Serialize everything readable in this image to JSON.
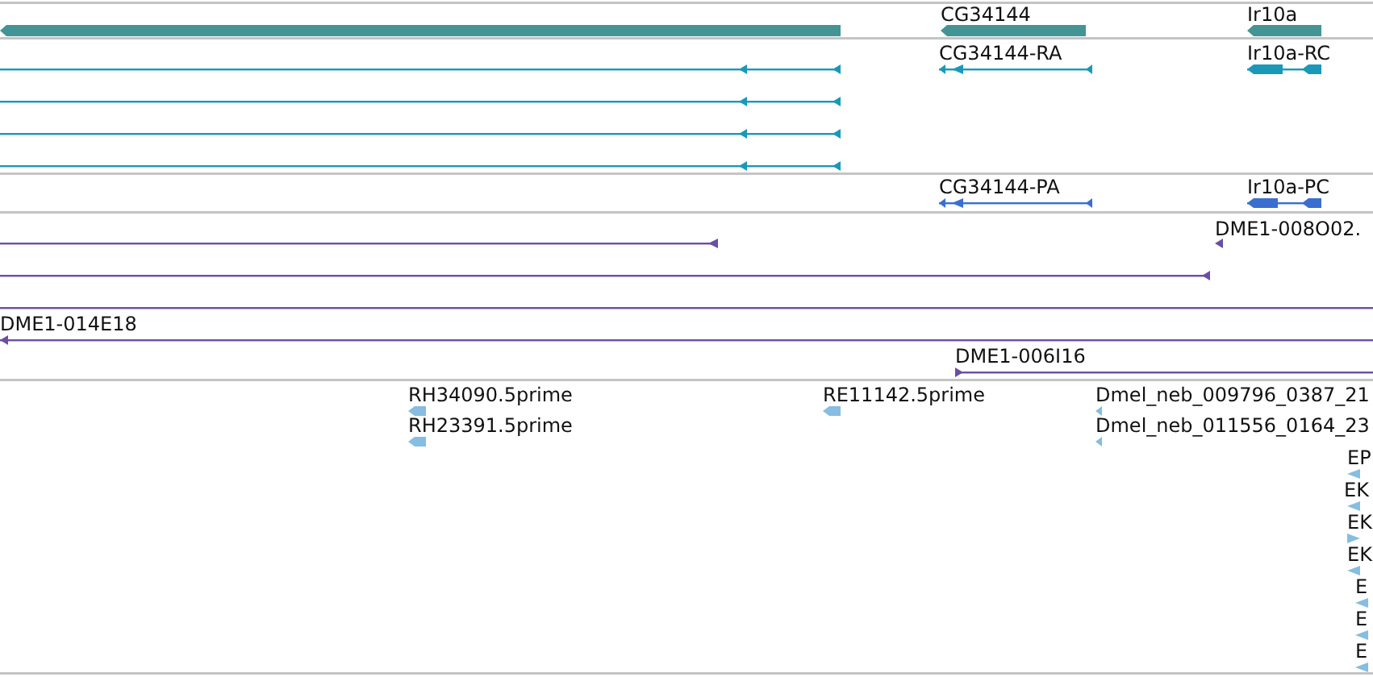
{
  "tracks": [
    {
      "kind": "gene",
      "color": "#449494",
      "features": [
        {
          "reverse": true
        },
        {
          "label": "CG34144",
          "reverse": true
        },
        {
          "label": "Ir10a",
          "reverse": true
        }
      ]
    },
    {
      "kind": "transcript",
      "color": "#1b98b8",
      "features": [
        {
          "reverse": true
        },
        {
          "reverse": true
        },
        {
          "reverse": true
        },
        {
          "reverse": true
        },
        {
          "label": "CG34144-RA",
          "reverse": true
        },
        {
          "label": "Ir10a-RC",
          "reverse": true
        }
      ]
    },
    {
      "kind": "protein",
      "color": "#3a6fcf",
      "features": [
        {
          "label": "CG34144-PA",
          "reverse": true
        },
        {
          "label": "Ir10a-PC",
          "reverse": true
        }
      ]
    },
    {
      "kind": "clone",
      "color": "#6a4fa3",
      "features": [
        {
          "kind": "end",
          "reverse": true
        },
        {
          "kind": "end",
          "label": "DME1-008O02.",
          "reverse": true
        },
        {
          "kind": "end",
          "reverse": true
        },
        {
          "kind": "span"
        },
        {
          "kind": "end",
          "label": "DME1-014E18",
          "reverse": true
        },
        {
          "kind": "end",
          "label": "DME1-006I16",
          "reverse": false
        }
      ]
    },
    {
      "kind": "est",
      "color": "#86bde0",
      "features": [
        {
          "label": "RH34090.5prime",
          "reverse": true
        },
        {
          "label": "RH23391.5prime",
          "reverse": true
        },
        {
          "label": "RE11142.5prime",
          "reverse": true
        },
        {
          "label": "Dmel_neb_009796_0387_21",
          "reverse": true
        },
        {
          "label": "Dmel_neb_011556_0164_23",
          "reverse": true
        },
        {
          "label": "EP",
          "reverse": true
        },
        {
          "label": "EK",
          "reverse": true
        },
        {
          "label": "EK",
          "reverse": false
        },
        {
          "label": "EK",
          "reverse": true
        },
        {
          "label": "E",
          "reverse": true
        },
        {
          "label": "E",
          "reverse": true
        },
        {
          "label": "E",
          "reverse": true
        }
      ]
    }
  ]
}
